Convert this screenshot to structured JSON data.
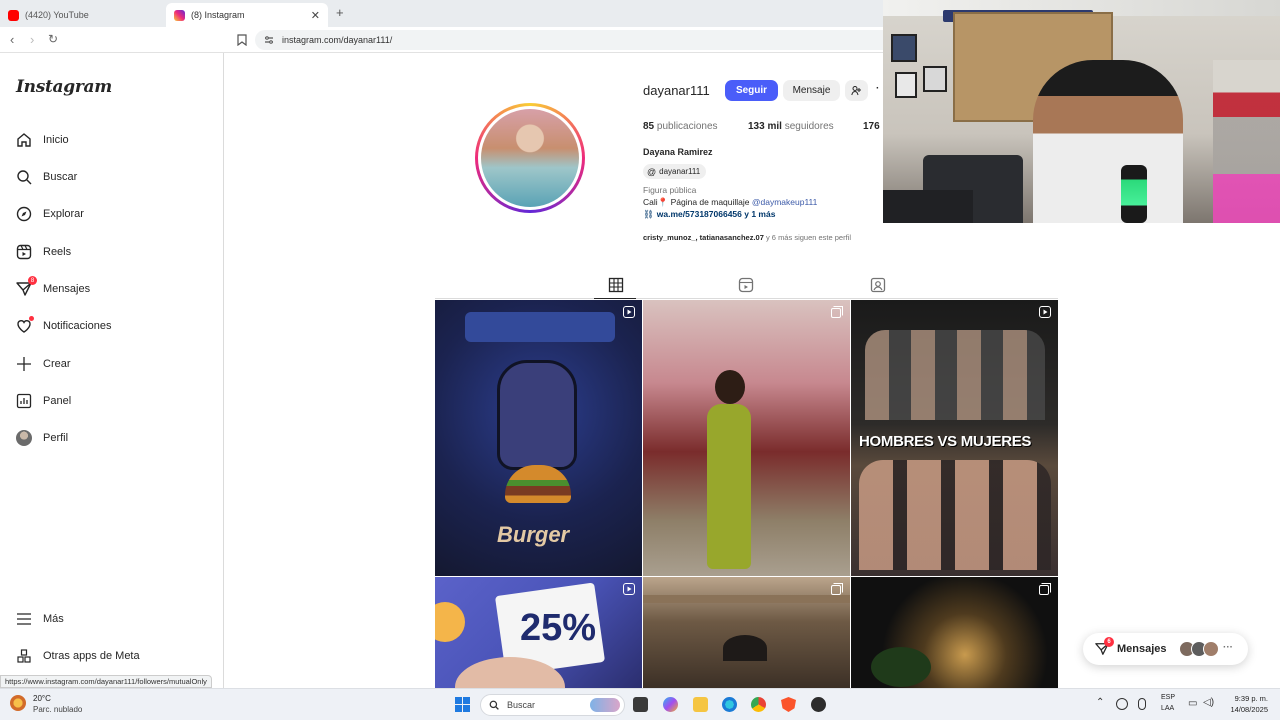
{
  "browser": {
    "tabs": [
      {
        "label": "(4420) YouTube",
        "active": false
      },
      {
        "label": "(8) Instagram",
        "active": true
      }
    ],
    "url": "instagram.com/dayanar111/",
    "status_url": "https://www.instagram.com/dayanar111/followers/mutualOnly"
  },
  "sidebar": {
    "logo": "Instagram",
    "items": [
      {
        "label": "Inicio",
        "icon": "home-icon"
      },
      {
        "label": "Buscar",
        "icon": "search-icon"
      },
      {
        "label": "Explorar",
        "icon": "compass-icon"
      },
      {
        "label": "Reels",
        "icon": "reels-icon"
      },
      {
        "label": "Mensajes",
        "icon": "messenger-icon",
        "badge": "8"
      },
      {
        "label": "Notificaciones",
        "icon": "heart-icon"
      },
      {
        "label": "Crear",
        "icon": "plus-icon"
      },
      {
        "label": "Panel",
        "icon": "chart-icon"
      },
      {
        "label": "Perfil",
        "icon": "avatar-icon"
      }
    ],
    "bottom": [
      {
        "label": "Más",
        "icon": "menu-icon"
      },
      {
        "label": "Otras apps de Meta",
        "icon": "meta-apps-icon"
      }
    ]
  },
  "profile": {
    "username": "dayanar111",
    "follow_label": "Seguir",
    "message_label": "Mensaje",
    "posts_count": "85",
    "posts_label": "publicaciones",
    "followers_count": "133 mil",
    "followers_label": "seguidores",
    "following_count": "176",
    "full_name": "Dayana Ramirez",
    "threads_handle": "dayanar111",
    "category": "Figura pública",
    "bio_prefix": "Cali📍 Página de maquillaje ",
    "bio_mention": "@daymakeup111",
    "link": "wa.me/573187066456 y 1 más",
    "mutuals_names": "cristy_munoz_, tatianasanchez.07",
    "mutuals_suffix": " y 6 más siguen este perfil"
  },
  "grid": {
    "tiles": [
      {
        "overlay": "Burger",
        "type": "reel"
      },
      {
        "overlay": "",
        "type": "carousel"
      },
      {
        "overlay": "HOMBRES VS MUJERES",
        "type": "reel"
      },
      {
        "overlay": "25%",
        "type": "reel"
      },
      {
        "overlay": "",
        "type": "carousel"
      },
      {
        "overlay": "",
        "type": "carousel"
      }
    ]
  },
  "floating_messages": {
    "label": "Mensajes",
    "badge": "6"
  },
  "taskbar": {
    "weather_temp": "20°C",
    "weather_desc": "Parc. nublado",
    "search_placeholder": "Buscar",
    "lang_top": "ESP",
    "lang_bottom": "LAA",
    "time": "9:39 p. m.",
    "date": "14/08/2025"
  },
  "colors": {
    "accent": "#4a5df9",
    "badge": "#ff3040",
    "link": "#3d5ba9"
  }
}
